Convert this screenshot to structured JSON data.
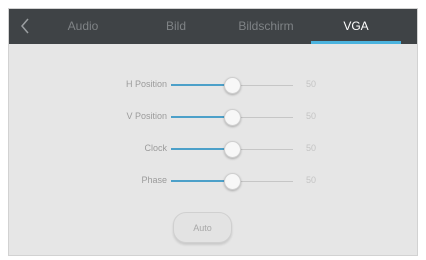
{
  "tabs": [
    {
      "label": "Audio",
      "active": false
    },
    {
      "label": "Bild",
      "active": false
    },
    {
      "label": "Bildschirm",
      "active": false
    },
    {
      "label": "VGA",
      "active": true
    }
  ],
  "settings": [
    {
      "label": "H Position",
      "value": "50",
      "level": 0.5
    },
    {
      "label": "V Position",
      "value": "50",
      "level": 0.5
    },
    {
      "label": "Clock",
      "value": "50",
      "level": 0.5
    },
    {
      "label": "Phase",
      "value": "50",
      "level": 0.5
    }
  ],
  "auto_button": {
    "label": "Auto"
  },
  "colors": {
    "tabbar_bg": "#3f4346",
    "accent": "#4bb3de",
    "slider_fill": "#4ca0c9",
    "panel_bg": "#e6e6e6"
  },
  "icons": {
    "back": "chevron-left-icon"
  }
}
